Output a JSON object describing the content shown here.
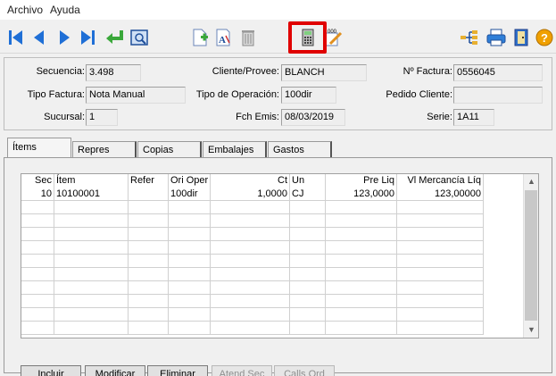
{
  "menu": {
    "items": [
      "Archivo",
      "Ayuda"
    ]
  },
  "toolbar": {
    "icons": [
      "first-record",
      "prev-record",
      "next-record",
      "last-record",
      "return",
      "preview",
      "new-document",
      "text-format",
      "trash",
      "calculator",
      "edit-numbers",
      "tree",
      "print",
      "exit-door",
      "help"
    ]
  },
  "header": {
    "secuencia": {
      "label": "Secuencia:",
      "value": "3.498"
    },
    "tipo_factura": {
      "label": "Tipo Factura:",
      "value": "Nota Manual"
    },
    "sucursal": {
      "label": "Sucursal:",
      "value": "1"
    },
    "cliente": {
      "label": "Cliente/Provee:",
      "value": "BLANCH"
    },
    "tipo_operacion": {
      "label": "Tipo de Operación:",
      "value": "100dir"
    },
    "fch_emis": {
      "label": "Fch Emis:",
      "value": "08/03/2019"
    },
    "n_factura": {
      "label": "Nº Factura:",
      "value": "0556045"
    },
    "pedido_cliente": {
      "label": "Pedido Cliente:",
      "value": ""
    },
    "serie": {
      "label": "Serie:",
      "value": "1A11"
    }
  },
  "tabs": [
    "Ítems",
    "Repres",
    "Copias",
    "Embalajes",
    "Gastos"
  ],
  "grid": {
    "columns": [
      "Sec",
      "Ítem",
      "Refer",
      "Ori Oper",
      "Ct",
      "Un",
      "Pre Liq",
      "Vl Mercancía Líq"
    ],
    "rows": [
      [
        "10",
        "10100001",
        "",
        "100dir",
        "1,0000",
        "CJ",
        "123,0000",
        "123,00000"
      ]
    ]
  },
  "buttons": {
    "incluir": "Incluir",
    "modificar": "Modificar",
    "eliminar": "Eliminar",
    "atend_sec": "Atend Sec",
    "calls_ord": "Calls Ord"
  },
  "colors": {
    "highlight": "#e00000",
    "toolbar_blue": "#1f6fd6",
    "arrow_green": "#3aa83a"
  }
}
